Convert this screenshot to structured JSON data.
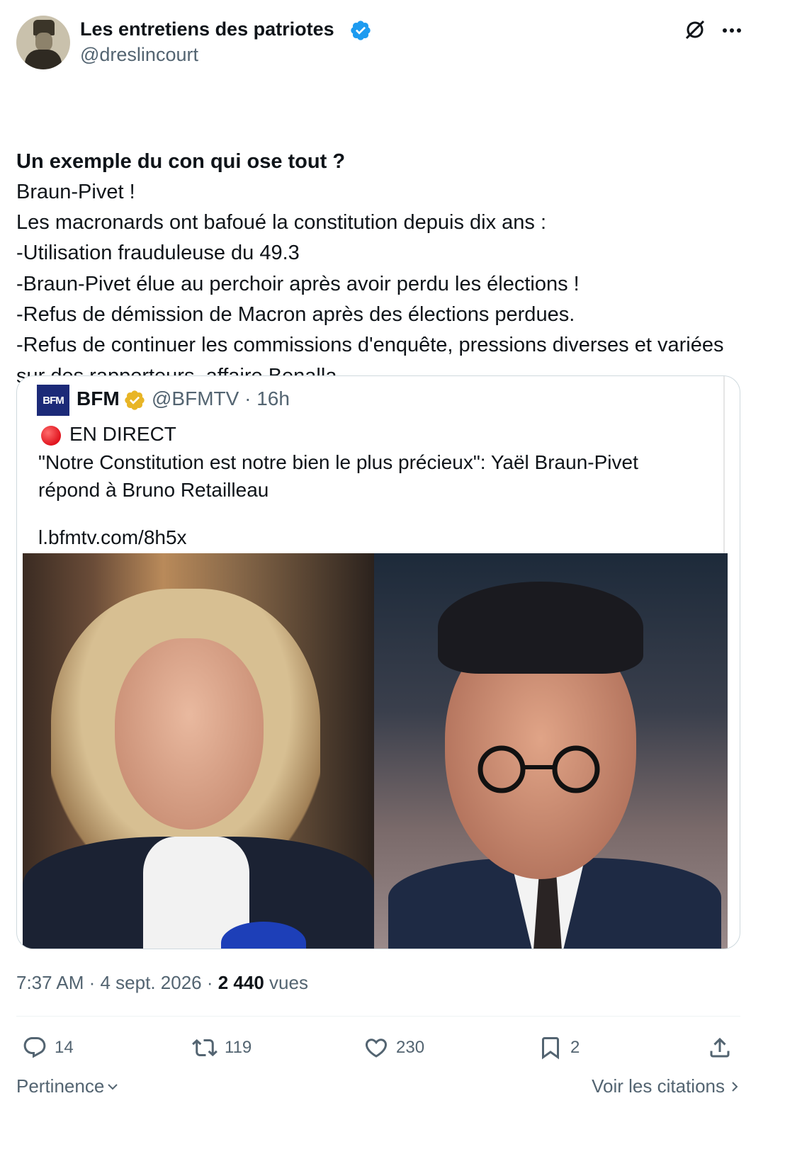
{
  "author": {
    "name": "Les entretiens des patriotes",
    "handle": "@dreslincourt",
    "verified_color": "#1d9bf0"
  },
  "tweet": {
    "lead": "Un exemple du con qui ose tout ?",
    "body": "Braun-Pivet !\nLes macronards ont bafoué la constitution depuis dix ans :\n-Utilisation frauduleuse du 49.3\n-Braun-Pivet élue au perchoir après avoir perdu les élections !\n-Refus de démission de Macron après des élections perdues.\n-Refus de continuer les commissions d'enquête, pressions diverses et variées sur des rapporteurs, affaire Benalla.....\nC'est infini..."
  },
  "quoted": {
    "logo_text": "BFM",
    "name": "BFM",
    "meta": "@BFMTV · 16h",
    "badge_color": "#e8b526",
    "live_label": "EN DIRECT",
    "text": "\"Notre Constitution est notre bien le plus précieux\": Yaël Braun-Pivet répond à Bruno Retailleau",
    "link": "l.bfmtv.com/8h5x"
  },
  "meta": {
    "time_date": "7:37 AM · 4 sept. 2026 · ",
    "views_count": "2 440",
    "views_label": " vues"
  },
  "actions": {
    "replies": "14",
    "reposts": "119",
    "likes": "230",
    "bookmarks": "2"
  },
  "footer": {
    "sort_label": "Pertinence",
    "quotes_label": "Voir les citations"
  },
  "icons": [
    "avatar",
    "verified-icon",
    "grok-icon",
    "more-icon",
    "reply-icon",
    "repost-icon",
    "like-icon",
    "bookmark-icon",
    "share-icon",
    "chevron-down-icon",
    "chevron-right-icon"
  ]
}
